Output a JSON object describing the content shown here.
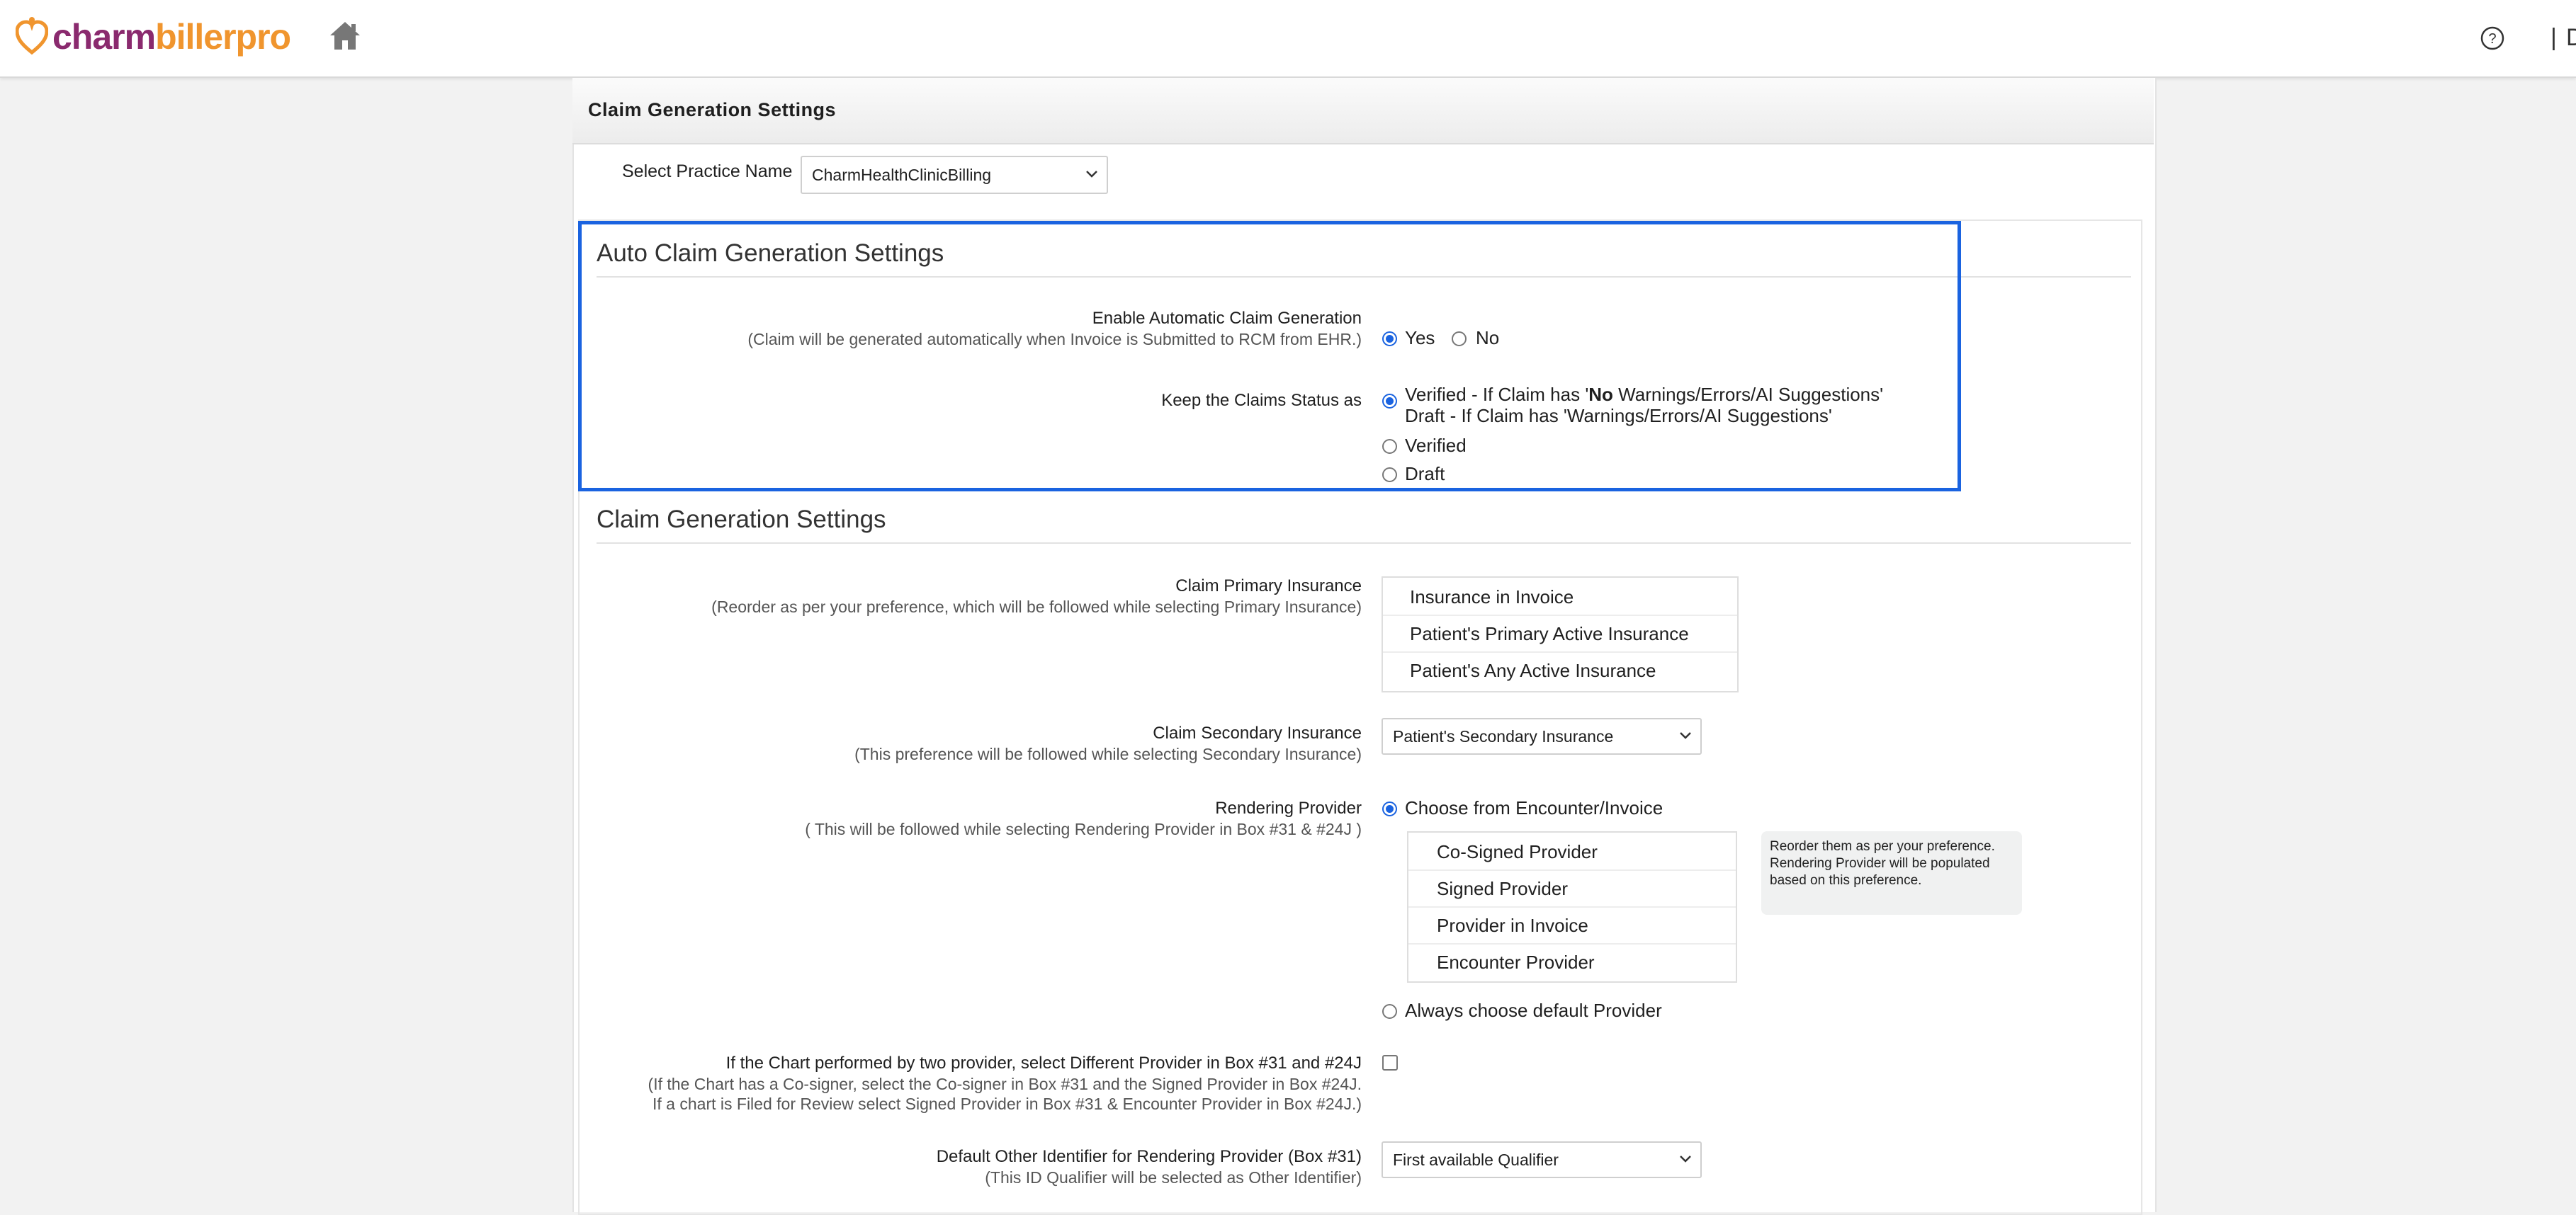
{
  "brand": {
    "charm": "charm",
    "biller": "billerpro",
    "accent": "#8a2a6e",
    "accent2": "#f0952e"
  },
  "topbar": {
    "separator": "|",
    "user_initial": "D"
  },
  "icons": {
    "home": "home-icon",
    "help": "help-icon",
    "heart": "heart-logo-icon",
    "chevron": "chevron-down-icon"
  },
  "panel": {
    "title": "Claim Generation Settings"
  },
  "practice": {
    "label": "Select Practice Name",
    "value": "CharmHealthClinicBilling"
  },
  "auto": {
    "title": "Auto Claim Generation Settings",
    "enable_label": "Enable Automatic Claim Generation",
    "enable_sub": "(Claim will be generated automatically when Invoice is Submitted to RCM from EHR.)",
    "yes": "Yes",
    "no": "No",
    "selected": "Yes",
    "status_label": "Keep the Claims Status as",
    "status_opt1_pre": "Verified - If Claim has '",
    "status_opt1_bold": "No",
    "status_opt1_post": " Warnings/Errors/AI Suggestions'",
    "status_opt1_line2": "Draft - If Claim has 'Warnings/Errors/AI Suggestions'",
    "status_opt2": "Verified",
    "status_opt3": "Draft"
  },
  "claim": {
    "title": "Claim Generation Settings",
    "primary_label": "Claim Primary Insurance",
    "primary_sub": "(Reorder as per your preference, which will be followed while selecting Primary Insurance)",
    "primary_items": [
      "Insurance in Invoice",
      "Patient's Primary Active Insurance",
      "Patient's Any Active Insurance"
    ],
    "secondary_label": "Claim Secondary Insurance",
    "secondary_sub": "(This preference will be followed while selecting Secondary Insurance)",
    "secondary_value": "Patient's Secondary Insurance",
    "rendering_label": "Rendering Provider",
    "rendering_sub": "( This will be followed while selecting Rendering Provider in Box #31 & #24J )",
    "rendering_opt1": "Choose from Encounter/Invoice",
    "rendering_items": [
      "Co-Signed Provider",
      "Signed Provider",
      "Provider in Invoice",
      "Encounter Provider"
    ],
    "rendering_tip": "Reorder them as per your preference. Rendering Provider will be populated based on this preference.",
    "rendering_opt2": "Always choose default Provider",
    "two_provider_label": "If the Chart performed by two provider, select Different Provider in Box #31 and #24J",
    "two_provider_sub1": "(If the Chart has a Co-signer, select the Co-signer in Box #31 and the Signed Provider in Box #24J.",
    "two_provider_sub2": "If a chart is Filed for Review select Signed Provider in Box #31 & Encounter Provider in Box #24J.)",
    "default_other_label": "Default Other Identifier for Rendering Provider (Box #31)",
    "default_other_sub": "(This ID Qualifier will be selected as Other Identifier)",
    "default_other_value": "First available Qualifier"
  }
}
